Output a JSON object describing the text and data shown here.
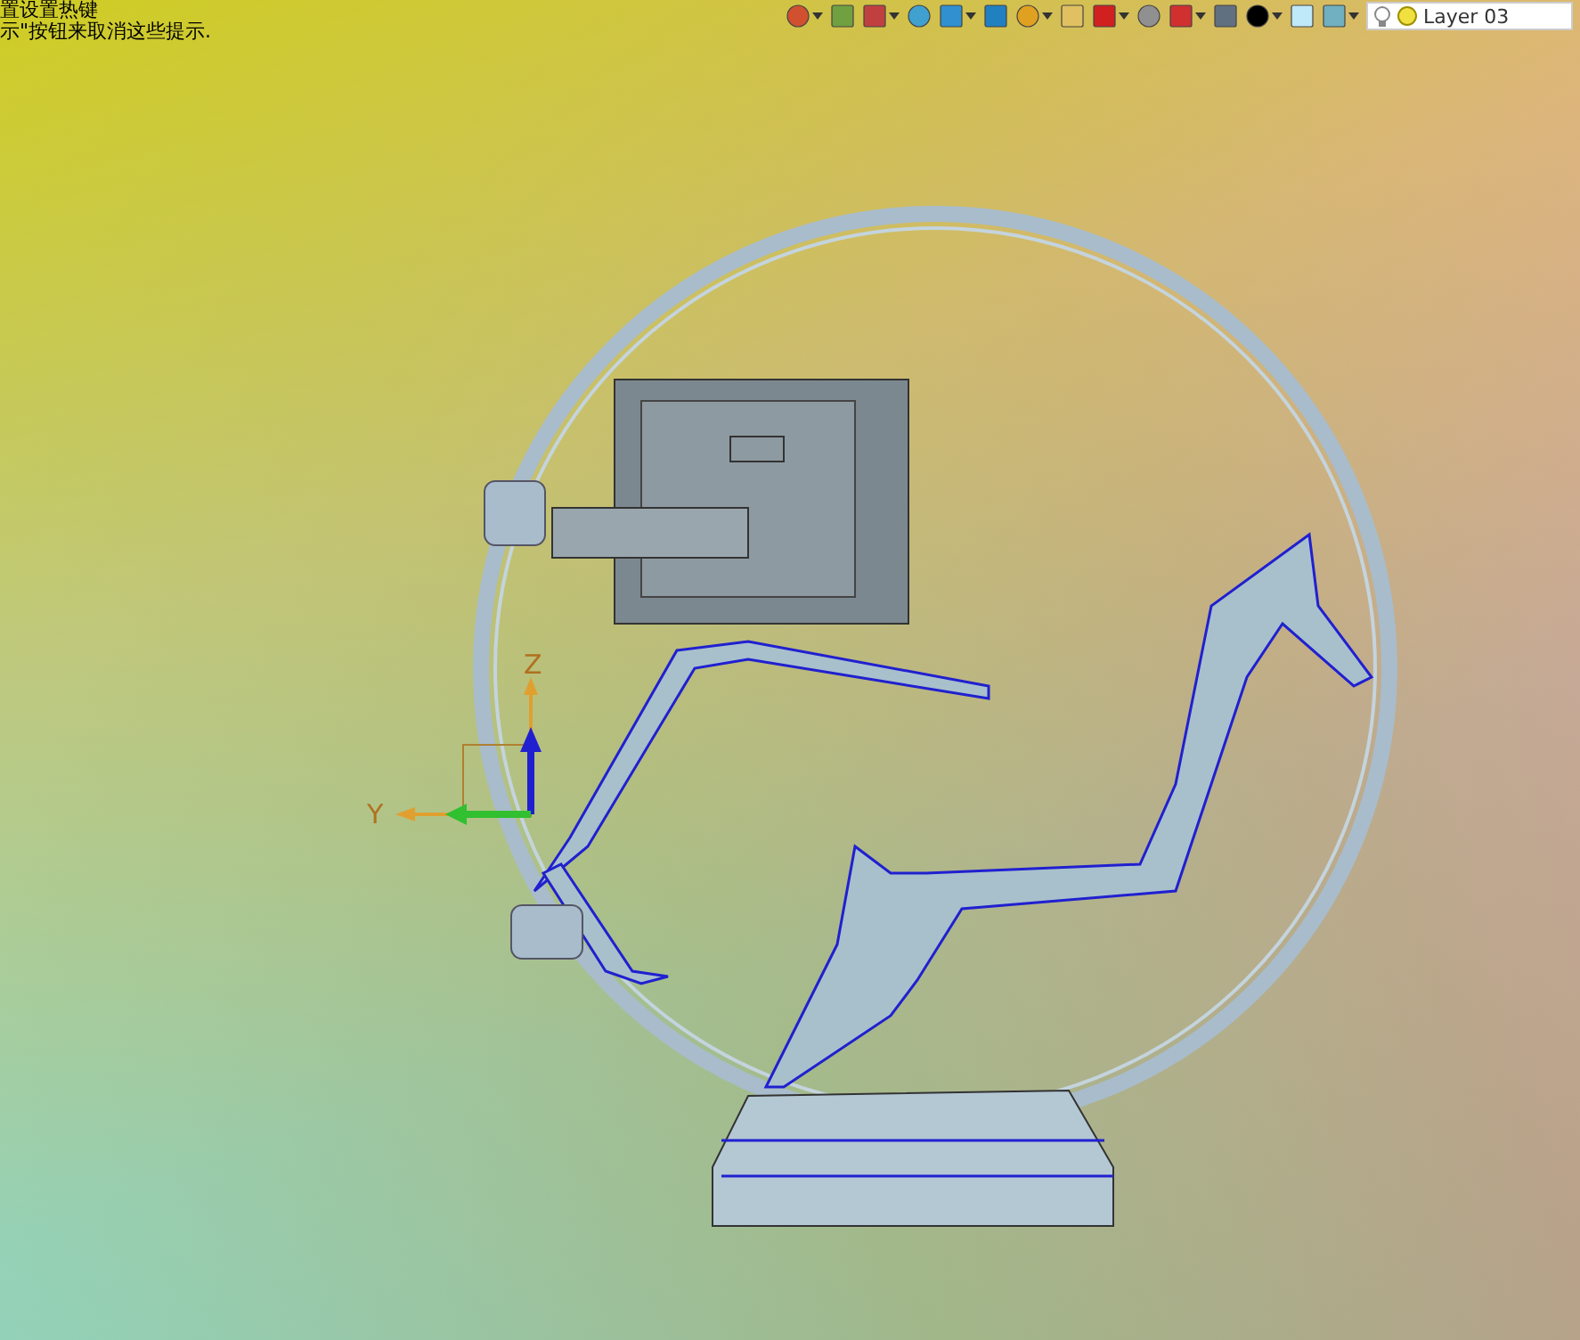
{
  "hint": {
    "lines": [
      "置设置热键",
      "示\"按钮来取消这些提示."
    ]
  },
  "toolbar": {
    "layer": {
      "value": "Layer 03"
    }
  },
  "triad": {
    "x_label": "Y",
    "z_label": "Z"
  }
}
